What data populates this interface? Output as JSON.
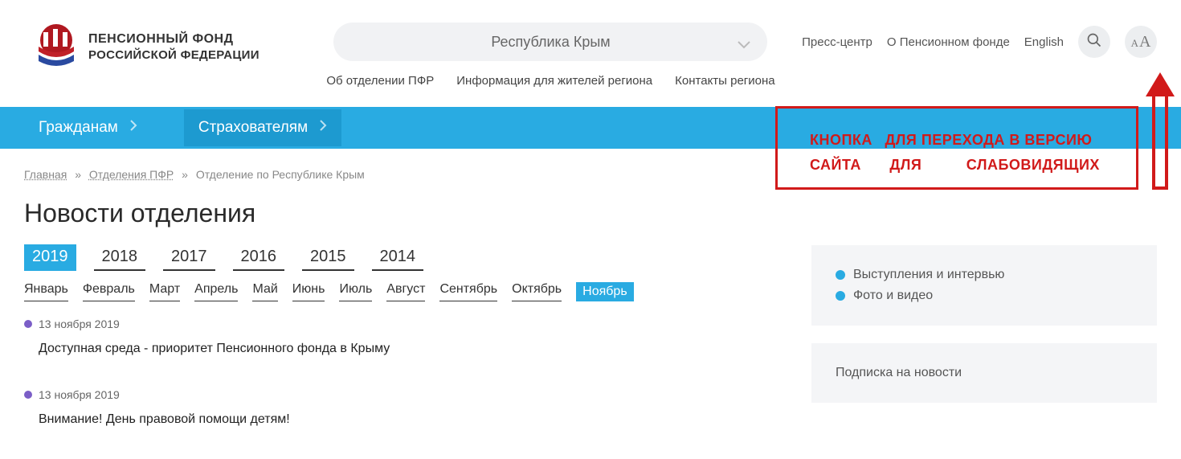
{
  "logo": {
    "line1": "ПЕНСИОННЫЙ ФОНД",
    "line2": "РОССИЙСКОЙ ФЕДЕРАЦИИ"
  },
  "region_selected": "Республика Крым",
  "subnav": {
    "about": "Об отделении ПФР",
    "info": "Информация для жителей региона",
    "contacts": "Контакты региона"
  },
  "right_links": {
    "press": "Пресс-центр",
    "about_fund": "О Пенсионном фонде",
    "english": "English"
  },
  "blue_nav": {
    "citizens": "Гражданам",
    "insurers": "Страхователям"
  },
  "breadcrumb": {
    "home": "Главная",
    "sep": "»",
    "departments": "Отделения ПФР",
    "current": "Отделение по Республике Крым"
  },
  "page_title": "Новости отделения",
  "years": [
    "2019",
    "2018",
    "2017",
    "2016",
    "2015",
    "2014"
  ],
  "year_active": "2019",
  "months": [
    "Январь",
    "Февраль",
    "Март",
    "Апрель",
    "Май",
    "Июнь",
    "Июль",
    "Август",
    "Сентябрь",
    "Октябрь",
    "Ноябрь"
  ],
  "month_active": "Ноябрь",
  "news": [
    {
      "date": "13 ноября 2019",
      "title": "Доступная среда - приоритет Пенсионного фонда в Крыму"
    },
    {
      "date": "13 ноября 2019",
      "title": "Внимание! День правовой помощи детям!"
    }
  ],
  "sidebar": {
    "links": {
      "speeches": "Выступления и интервью",
      "media": "Фото и видео"
    },
    "subscribe_title": "Подписка на новости"
  },
  "annotation": {
    "row1a": "КНОПКА",
    "row1b": "ДЛЯ ПЕРЕХОДА В ВЕРСИЮ",
    "row2a": "САЙТА",
    "row2b": "ДЛЯ",
    "row2c": "СЛАБОВИДЯЩИХ"
  }
}
